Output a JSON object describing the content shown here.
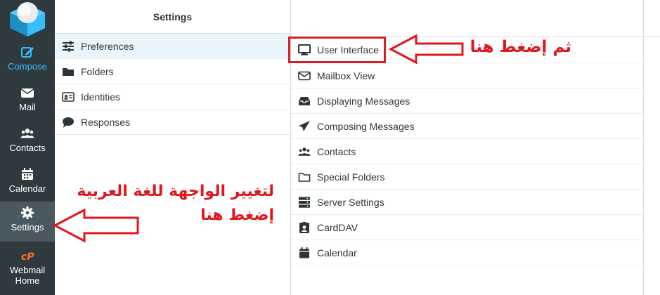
{
  "sidebar": {
    "items": [
      {
        "label": "Compose",
        "icon": "compose-icon"
      },
      {
        "label": "Mail",
        "icon": "envelope-icon"
      },
      {
        "label": "Contacts",
        "icon": "users-icon"
      },
      {
        "label": "Calendar",
        "icon": "calendar-icon"
      },
      {
        "label": "Settings",
        "icon": "gear-icon"
      },
      {
        "label_line1": "Webmail",
        "label_line2": "Home",
        "icon": "cpanel-icon"
      }
    ]
  },
  "settings": {
    "title": "Settings",
    "items": [
      {
        "label": "Preferences",
        "icon": "sliders-icon"
      },
      {
        "label": "Folders",
        "icon": "folder-icon"
      },
      {
        "label": "Identities",
        "icon": "id-card-icon"
      },
      {
        "label": "Responses",
        "icon": "comment-icon"
      }
    ]
  },
  "preferences": {
    "items": [
      {
        "label": "User Interface",
        "icon": "monitor-icon"
      },
      {
        "label": "Mailbox View",
        "icon": "envelope-outline-icon"
      },
      {
        "label": "Displaying Messages",
        "icon": "inbox-icon"
      },
      {
        "label": "Composing Messages",
        "icon": "paper-plane-icon"
      },
      {
        "label": "Contacts",
        "icon": "users-icon"
      },
      {
        "label": "Special Folders",
        "icon": "folder-outline-icon"
      },
      {
        "label": "Server Settings",
        "icon": "server-icon"
      },
      {
        "label": "CardDAV",
        "icon": "contact-badge-icon"
      },
      {
        "label": "Calendar",
        "icon": "calendar-icon"
      }
    ]
  },
  "annotations": {
    "top": "ثم إضغط هنا",
    "bottom_line1": "لتغيير الواجهة للغة العربية",
    "bottom_line2": "إضغط هنا",
    "color": "#e3151c"
  },
  "colors": {
    "sidebar_bg": "#2f3a3f",
    "accent": "#37beff",
    "highlight": "#d31f26"
  }
}
